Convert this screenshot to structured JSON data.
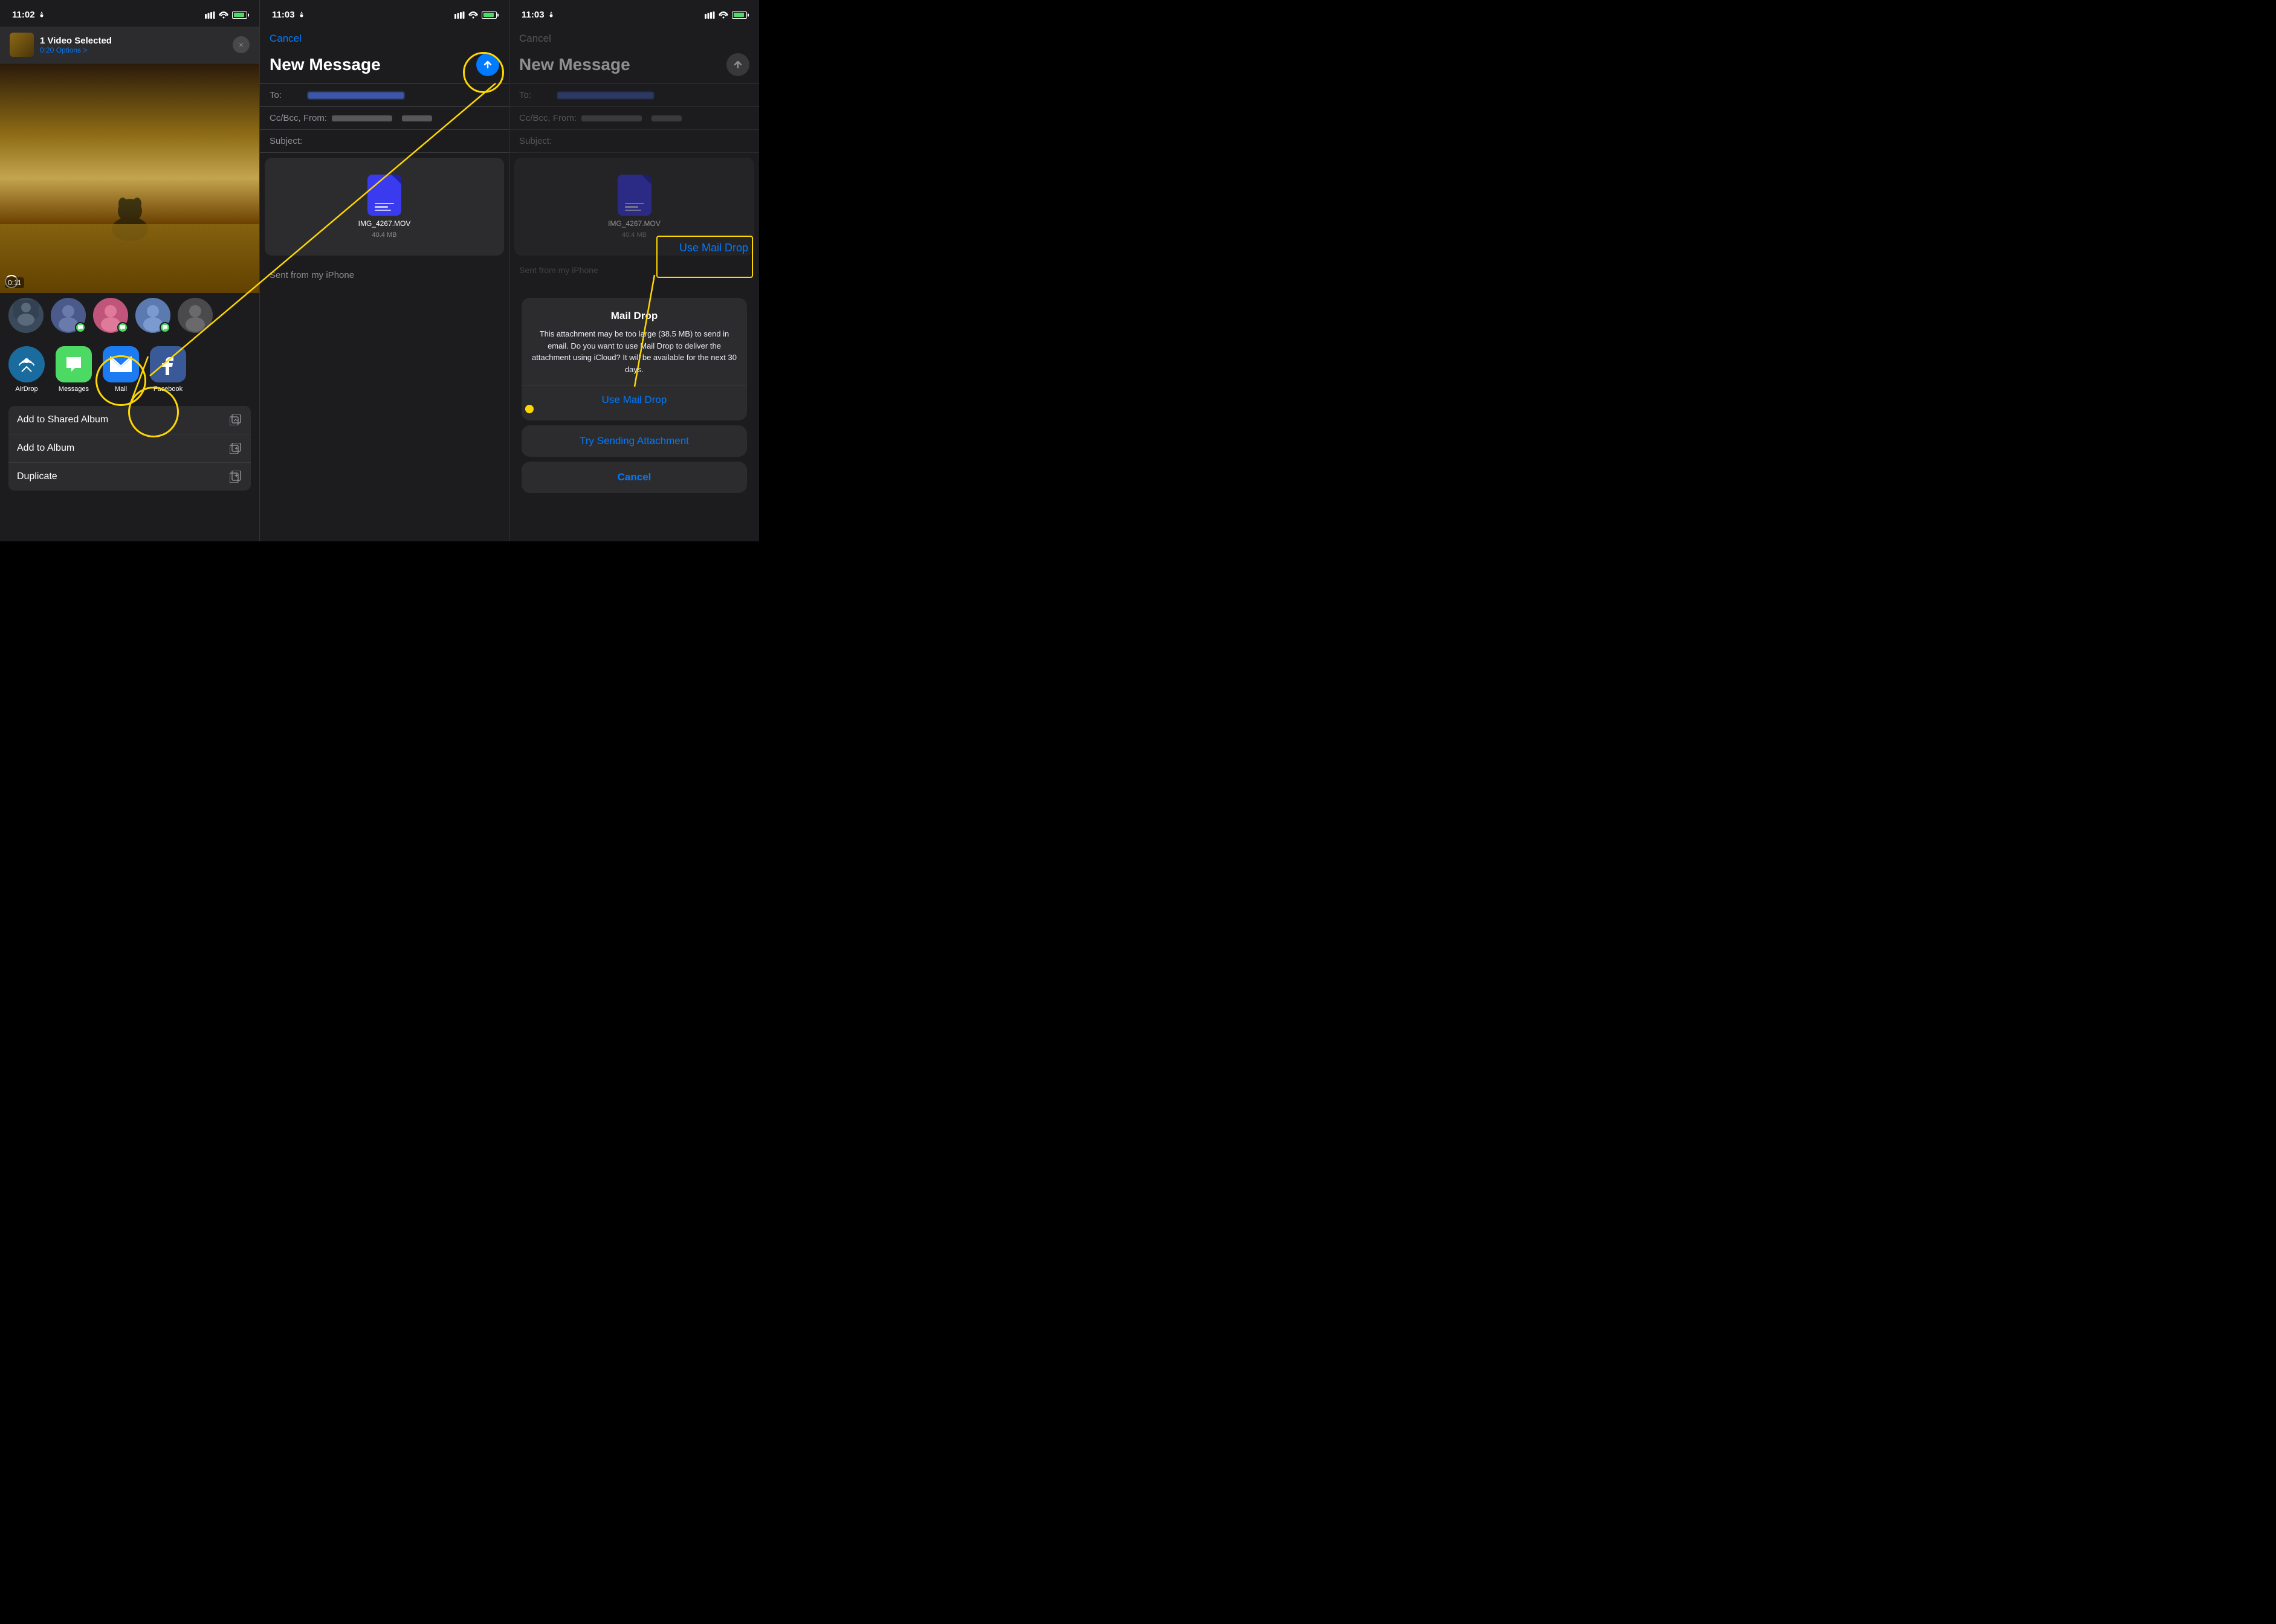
{
  "screens": [
    {
      "id": "screen1",
      "time": "11:02",
      "header": {
        "title": "1 Video Selected",
        "subtitle": "0:20  Options >",
        "close": "×"
      },
      "photo": {
        "timestamp": "0:11"
      },
      "shareIcons": [
        {
          "id": "airdrop",
          "label": "AirDrop",
          "emoji": "📡"
        },
        {
          "id": "messages",
          "label": "Messages",
          "emoji": "💬"
        },
        {
          "id": "mail",
          "label": "Mail",
          "emoji": "✉️"
        },
        {
          "id": "facebook",
          "label": "Facebook",
          "emoji": "f"
        },
        {
          "id": "more",
          "label": "",
          "emoji": "···"
        }
      ],
      "actions": [
        {
          "text": "Add to Shared Album",
          "icon": "📁"
        },
        {
          "text": "Add to Album",
          "icon": "📁"
        },
        {
          "text": "Duplicate",
          "icon": "📋"
        }
      ]
    },
    {
      "id": "screen2",
      "time": "11:03",
      "cancel": "Cancel",
      "title": "New Message",
      "fields": [
        {
          "label": "To:"
        },
        {
          "label": "Cc/Bcc, From:"
        },
        {
          "label": "Subject:"
        }
      ],
      "attachment": {
        "name": "IMG_4267.MOV",
        "size": "40.4 MB"
      },
      "sentFrom": "Sent from my iPhone"
    },
    {
      "id": "screen3",
      "time": "11:03",
      "cancel": "Cancel",
      "title": "New Message",
      "fields": [
        {
          "label": "To:"
        },
        {
          "label": "Cc/Bcc, From:"
        },
        {
          "label": "Subject:"
        }
      ],
      "attachment": {
        "name": "IMG_4267.MOV",
        "size": "40.4 MB"
      },
      "sentFrom": "Sent from my iPhone",
      "dialog": {
        "title": "Mail Drop",
        "body": "This attachment may be too large (38.5 MB) to send in email. Do you want to use Mail Drop to deliver the attachment using iCloud? It will be available for the next 30 days.",
        "useMailDrop": "Use Mail Drop",
        "trySending": "Try Sending Attachment",
        "cancel": "Cancel"
      }
    }
  ]
}
